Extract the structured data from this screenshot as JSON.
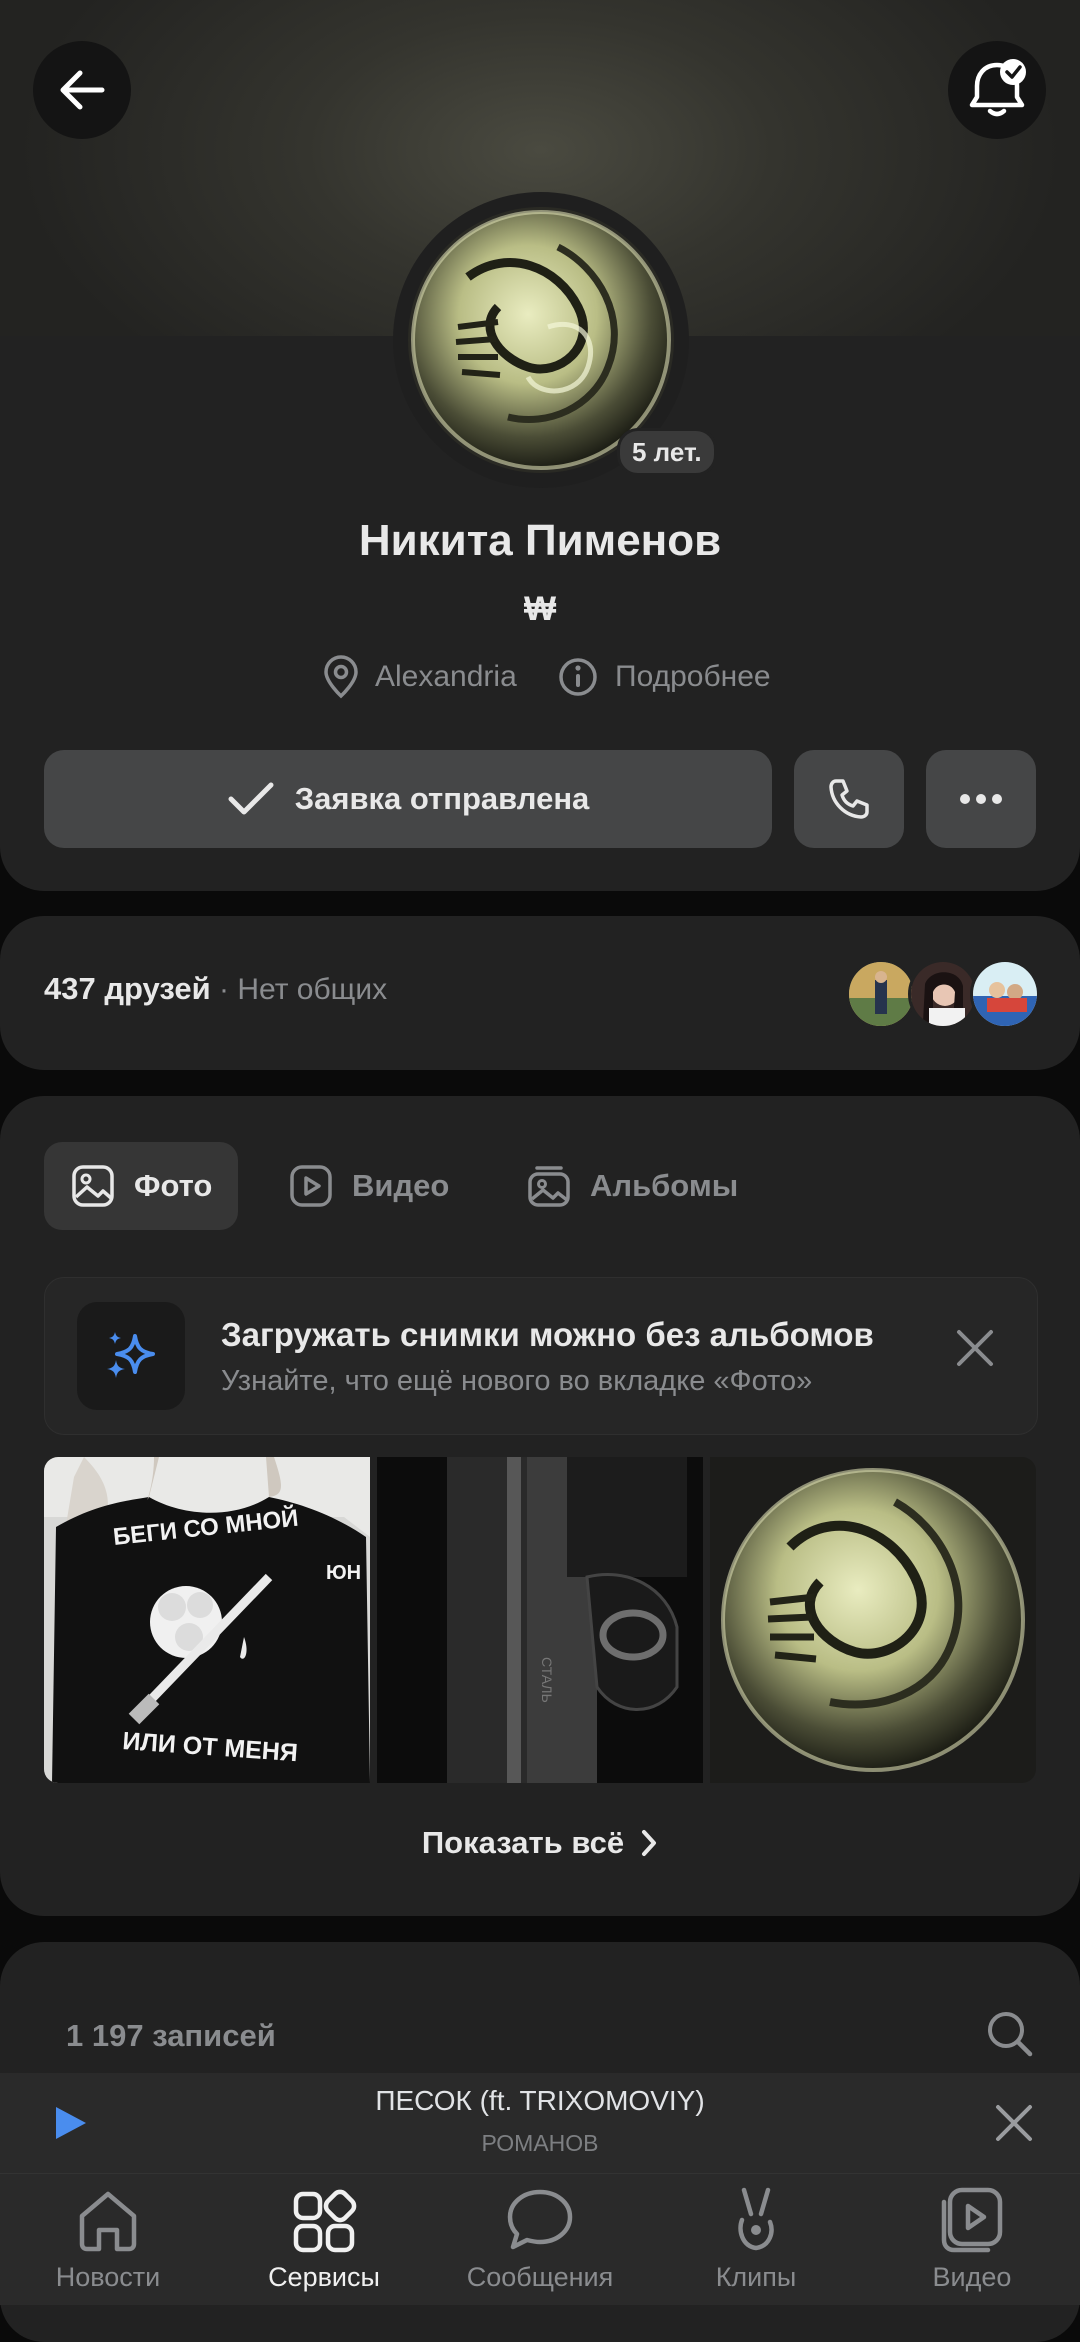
{
  "profile": {
    "name": "Никита Пименов",
    "status_symbol": "₩",
    "age_badge": "5 лет.",
    "city": "Alexandria",
    "details_label": "Подробнее",
    "request_button": "Заявка отправлена"
  },
  "friends": {
    "count_label": "437 друзей",
    "separator": " · ",
    "common_label": "Нет общих"
  },
  "media_tabs": [
    "Фото",
    "Видео",
    "Альбомы"
  ],
  "banner": {
    "title": "Загружать снимки можно без альбомов",
    "subtitle": "Узнайте, что ещё нового во вкладке «Фото»"
  },
  "photos": {
    "shirt_text_top": "БЕГИ СО МНОЙ",
    "shirt_text_side": "ЮН",
    "shirt_text_bottom": "ИЛИ ОТ МЕНЯ",
    "gun_text": "СТАЛЬ"
  },
  "show_all": "Показать всё",
  "posts": {
    "count_label": "1 197 записей"
  },
  "player": {
    "track": "ПЕСОК (ft. TRIXOMOVIY)",
    "artist": "РОМАНОВ"
  },
  "tabbar": [
    "Новости",
    "Сервисы",
    "Сообщения",
    "Клипы",
    "Видео"
  ],
  "tabbar_active_index": 1,
  "colors": {
    "accent": "#4a8dee",
    "card": "#222222",
    "background": "#0a0a0a"
  }
}
